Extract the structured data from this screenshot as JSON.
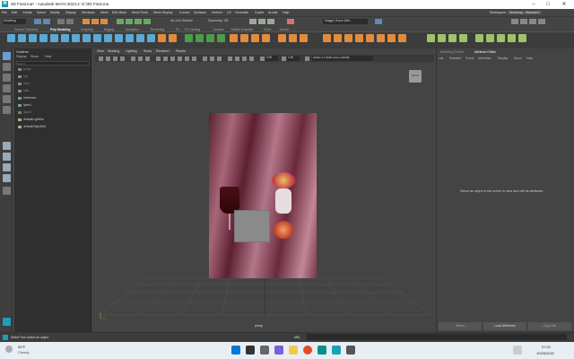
{
  "app": {
    "title": "3D Final.ma* - Autodesk MAYA 2023.2: D:\\3D Final.ma",
    "icon_letter": "M",
    "win_buttons": [
      "–",
      "□",
      "✕"
    ]
  },
  "menubar": {
    "items": [
      "File",
      "Edit",
      "Create",
      "Select",
      "Modify",
      "Display",
      "Windows",
      "Mesh",
      "Edit Mesh",
      "Mesh Tools",
      "Mesh Display",
      "Curves",
      "Surfaces",
      "Deform",
      "UV",
      "Generate",
      "Cache",
      "Arnold",
      "Help"
    ],
    "workspace_label": "Workspace:",
    "workspace_value": "Modeling - Standard*"
  },
  "statusline": {
    "mode": "Modeling",
    "no_live": "No Live Surface",
    "symmetry": "Symmetry: Off",
    "user": "Maggie Grace Weh..."
  },
  "shelf": {
    "tabs": [
      "Curves / Surfaces",
      "Poly Modeling",
      "Sculpting",
      "Rigging",
      "Animation",
      "Rendering",
      "FX",
      "FX Caching",
      "Custom",
      "Motion Graphics",
      "XGen",
      "Arnold"
    ]
  },
  "outliner": {
    "title": "Outliner",
    "menu": [
      "Display",
      "Show",
      "Help"
    ],
    "search_placeholder": "Search...",
    "items": [
      "persp",
      "top",
      "front",
      "side",
      "reference",
      "ipom1",
      "ipom2",
      "defaultLightSet",
      "defaultObjectSet"
    ]
  },
  "viewport": {
    "menu": [
      "View",
      "Shading",
      "Lighting",
      "Show",
      "Renderer",
      "Panels"
    ],
    "camera_label": "persp",
    "color_space": "ACES 1.0 SDR-video (sRGB)",
    "field_a": "0.00",
    "field_b": "1.00",
    "viewcube_label": "FRONT"
  },
  "attribute_editor": {
    "tabs": [
      "Modeling Toolkit",
      "Attribute Editor"
    ],
    "menu": [
      "List",
      "Selected",
      "Focus",
      "Attributes",
      "Display",
      "Show",
      "Help"
    ],
    "message": "Select an object in the scene to view and edit its attributes",
    "buttons": [
      "Select",
      "Load Attributes",
      "Copy Tab"
    ]
  },
  "helpline": {
    "text": "Select Tool: select an object",
    "mel": "MEL"
  },
  "taskbar": {
    "weather_temp": "59°F",
    "weather_text": "Cloudy",
    "time": "07:02",
    "date": "10/26/2022"
  },
  "colors": {
    "accent": "#e38b3c",
    "maya_teal": "#1aa0b8"
  }
}
